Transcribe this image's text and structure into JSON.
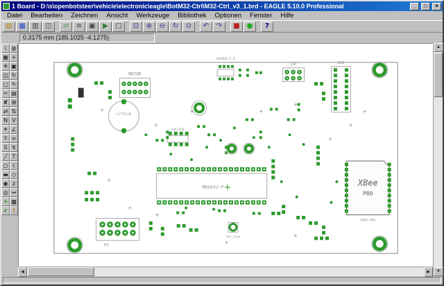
{
  "window": {
    "title": "1 Board - D:\\s\\openbotsteer\\vehicle\\electronic\\eagle\\BotM32-Ctrl\\M32-Ctrl_v3_1.brd - EAGLE 5.10.0 Professional",
    "controls": {
      "minimize": "_",
      "maximize": "□",
      "close": "×"
    }
  },
  "menu": {
    "items": [
      "Datei",
      "Bearbeiten",
      "Zeichnen",
      "Ansicht",
      "Werkzeuge",
      "Bibliothek",
      "Optionen",
      "Fenster",
      "Hilfe"
    ]
  },
  "toolbar": {
    "icons": [
      {
        "name": "open-file",
        "glyph": "▤"
      },
      {
        "name": "save",
        "glyph": "▦"
      },
      {
        "name": "print",
        "glyph": "▥"
      },
      {
        "name": "cam-processor",
        "glyph": "◫"
      },
      {
        "name": "board-schematic",
        "glyph": "▱"
      },
      {
        "name": "library",
        "glyph": "≡"
      },
      {
        "name": "script",
        "glyph": "▣"
      },
      {
        "name": "run-script",
        "glyph": "▶"
      },
      {
        "name": "new-window",
        "glyph": "□"
      },
      {
        "name": "zoom-fit",
        "glyph": "⊡"
      },
      {
        "name": "zoom-in",
        "glyph": "⊕"
      },
      {
        "name": "zoom-out",
        "glyph": "⊖"
      },
      {
        "name": "zoom-redraw",
        "glyph": "↻"
      },
      {
        "name": "zoom-select",
        "glyph": "⊙"
      },
      {
        "name": "undo",
        "glyph": "↶"
      },
      {
        "name": "redo",
        "glyph": "↷"
      },
      {
        "name": "stop",
        "glyph": "■"
      },
      {
        "name": "go",
        "glyph": "●"
      },
      {
        "name": "help",
        "glyph": "?"
      }
    ]
  },
  "coordbar": {
    "position": "0.3175 mm (185.1025 -4.1275)"
  },
  "palette": {
    "tools": [
      {
        "name": "info",
        "glyph": "i"
      },
      {
        "name": "show",
        "glyph": "◍"
      },
      {
        "name": "display",
        "glyph": "▦"
      },
      {
        "name": "mark",
        "glyph": "+"
      },
      {
        "name": "move",
        "glyph": "✛"
      },
      {
        "name": "copy",
        "glyph": "▣"
      },
      {
        "name": "mirror",
        "glyph": "◫"
      },
      {
        "name": "rotate",
        "glyph": "↻"
      },
      {
        "name": "group",
        "glyph": "▢"
      },
      {
        "name": "change",
        "glyph": "✎"
      },
      {
        "name": "cut",
        "glyph": "✂"
      },
      {
        "name": "paste",
        "glyph": "▤"
      },
      {
        "name": "delete",
        "glyph": "✘"
      },
      {
        "name": "add",
        "glyph": "⊞"
      },
      {
        "name": "pinswap",
        "glyph": "⇄"
      },
      {
        "name": "replace",
        "glyph": "⇅"
      },
      {
        "name": "name",
        "glyph": "N"
      },
      {
        "name": "value",
        "glyph": "V"
      },
      {
        "name": "smash",
        "glyph": "✶"
      },
      {
        "name": "miter",
        "glyph": "∠"
      },
      {
        "name": "split",
        "glyph": "Y"
      },
      {
        "name": "optimize",
        "glyph": "≈"
      },
      {
        "name": "route",
        "glyph": "S"
      },
      {
        "name": "ripup",
        "glyph": "↯"
      },
      {
        "name": "wire",
        "glyph": "╱"
      },
      {
        "name": "text",
        "glyph": "T"
      },
      {
        "name": "circle",
        "glyph": "○"
      },
      {
        "name": "arc",
        "glyph": "("
      },
      {
        "name": "rect",
        "glyph": "▬"
      },
      {
        "name": "polygon",
        "glyph": "◇"
      },
      {
        "name": "via",
        "glyph": "◉"
      },
      {
        "name": "signal",
        "glyph": "z"
      },
      {
        "name": "hole",
        "glyph": "◎"
      },
      {
        "name": "dimension",
        "glyph": "↔"
      },
      {
        "name": "ratsnest",
        "glyph": "✳"
      },
      {
        "name": "auto",
        "glyph": "▩"
      },
      {
        "name": "drc",
        "glyph": "✔"
      },
      {
        "name": "errors",
        "glyph": "!"
      }
    ]
  },
  "scrollbar": {
    "up": "▲",
    "down": "▼",
    "left": "◀",
    "right": "▶"
  },
  "pcb": {
    "labels": {
      "motor": "MOTOR",
      "regulator": "LM2904-5.0",
      "isp": "ISP",
      "lcd": "LCD",
      "battery": "Lithium",
      "eeprom": "24LC256",
      "mcu": "MEGA32-P",
      "xbee_logo": "XBee",
      "xbee_pro": "PRO",
      "xbee_ref": "XBEE-PRO",
      "pc": "PC",
      "pot": "Pot trim"
    },
    "colors": {
      "pad": "#2d9a2d",
      "silk": "#969696"
    }
  }
}
